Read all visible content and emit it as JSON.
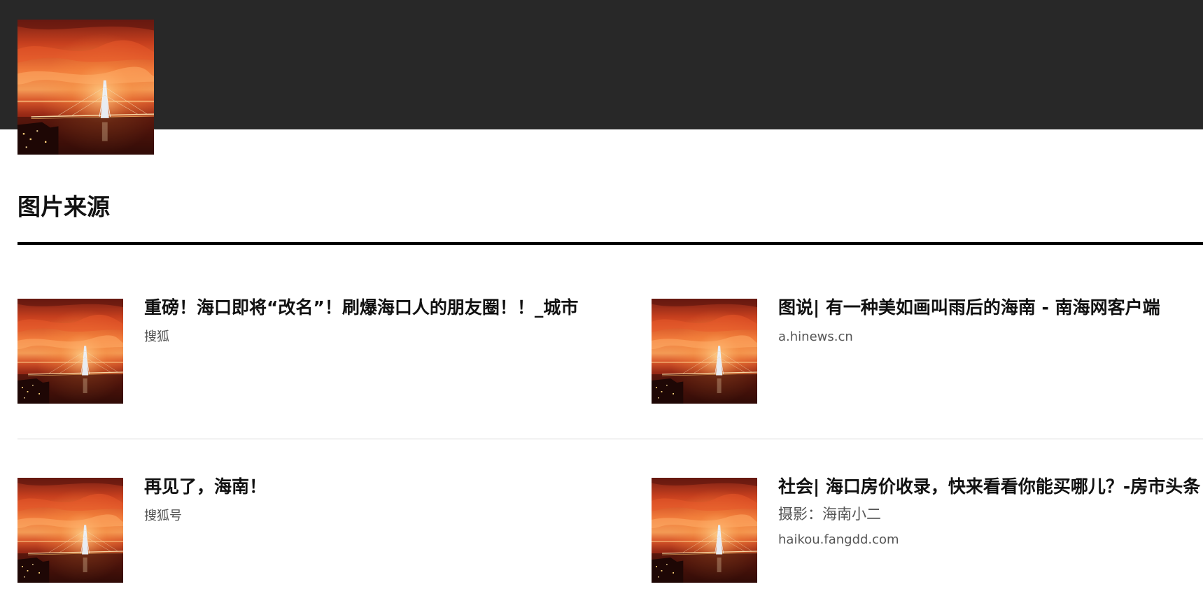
{
  "header": {
    "background_color": "#282828",
    "hero_image": "sunset-bridge-photo"
  },
  "section": {
    "title": "图片来源"
  },
  "results": [
    {
      "title": "重磅！海口即将“改名”！刷爆海口人的朋友圈！！_城市",
      "source": "搜狐",
      "image": "sunset-bridge-photo"
    },
    {
      "title": "图说| 有一种美如画叫雨后的海南 - 南海网客户端",
      "source": "a.hinews.cn",
      "image": "sunset-bridge-photo"
    },
    {
      "title": "再见了，海南！",
      "source": "搜狐号",
      "image": "sunset-bridge-photo"
    },
    {
      "title": "社会| 海口房价收录，快来看看你能买哪儿？-房市头条",
      "credit": "摄影：海南小二",
      "source": "haikou.fangdd.com",
      "image": "sunset-bridge-photo"
    }
  ]
}
